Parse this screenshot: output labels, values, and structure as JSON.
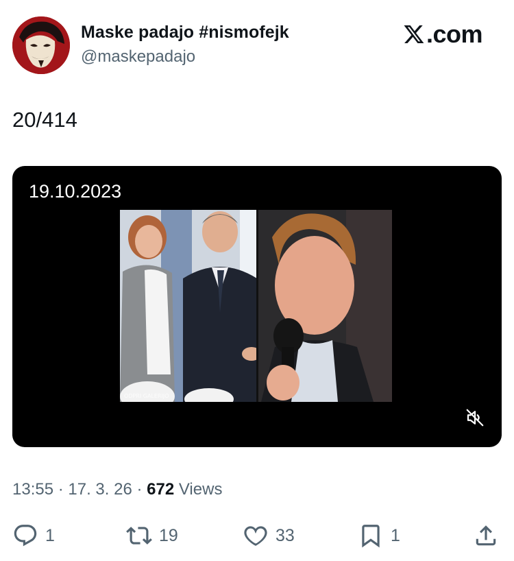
{
  "tweet": {
    "author": {
      "display_name": "Maske padajo #nismofejk",
      "handle": "@maskepadajo",
      "avatar_icon": "guy-fawkes-mask-avatar"
    },
    "brand": {
      "icon": "x-logo-icon",
      "label": ".com"
    },
    "text": "20/414",
    "media": {
      "overlay_date": "19.10.2023",
      "watermark": "ODPRI GALERIJO",
      "mute_icon": "speaker-muted-icon"
    },
    "meta": {
      "time": "13:55",
      "sep1": " · ",
      "date": "17. 3. 26",
      "sep2": " · ",
      "views_count": "672",
      "views_label": " Views"
    },
    "actions": {
      "reply": {
        "icon": "reply-icon",
        "count": "1"
      },
      "repost": {
        "icon": "repost-icon",
        "count": "19"
      },
      "like": {
        "icon": "heart-icon",
        "count": "33"
      },
      "bookmark": {
        "icon": "bookmark-icon",
        "count": "1"
      },
      "share": {
        "icon": "share-icon"
      }
    }
  },
  "colors": {
    "text_primary": "#0f1419",
    "text_secondary": "#536471",
    "media_background": "#000000",
    "avatar_background": "#a3161a"
  }
}
